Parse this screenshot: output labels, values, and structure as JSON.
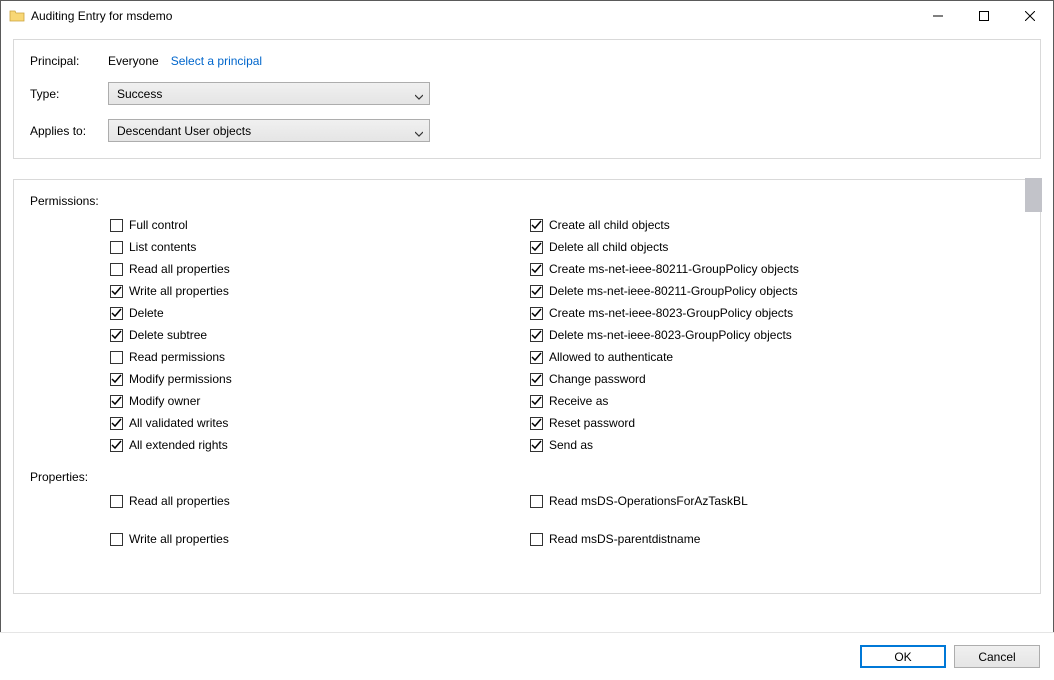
{
  "titlebar": {
    "title": "Auditing Entry for msdemo"
  },
  "top": {
    "principal_label": "Principal:",
    "principal_value": "Everyone",
    "principal_link": "Select a principal",
    "type_label": "Type:",
    "type_value": "Success",
    "applies_label": "Applies to:",
    "applies_value": "Descendant User objects"
  },
  "sections": {
    "permissions_label": "Permissions:",
    "properties_label": "Properties:"
  },
  "permissions_left": [
    {
      "label": "Full control",
      "checked": false
    },
    {
      "label": "List contents",
      "checked": false
    },
    {
      "label": "Read all properties",
      "checked": false
    },
    {
      "label": "Write all properties",
      "checked": true
    },
    {
      "label": "Delete",
      "checked": true
    },
    {
      "label": "Delete subtree",
      "checked": true
    },
    {
      "label": "Read permissions",
      "checked": false
    },
    {
      "label": "Modify permissions",
      "checked": true
    },
    {
      "label": "Modify owner",
      "checked": true
    },
    {
      "label": "All validated writes",
      "checked": true
    },
    {
      "label": "All extended rights",
      "checked": true
    }
  ],
  "permissions_right": [
    {
      "label": "Create all child objects",
      "checked": true
    },
    {
      "label": "Delete all child objects",
      "checked": true
    },
    {
      "label": "Create ms-net-ieee-80211-GroupPolicy objects",
      "checked": true
    },
    {
      "label": "Delete ms-net-ieee-80211-GroupPolicy objects",
      "checked": true
    },
    {
      "label": "Create ms-net-ieee-8023-GroupPolicy objects",
      "checked": true
    },
    {
      "label": "Delete ms-net-ieee-8023-GroupPolicy objects",
      "checked": true
    },
    {
      "label": "Allowed to authenticate",
      "checked": true
    },
    {
      "label": "Change password",
      "checked": true
    },
    {
      "label": "Receive as",
      "checked": true
    },
    {
      "label": "Reset password",
      "checked": true
    },
    {
      "label": "Send as",
      "checked": true
    }
  ],
  "properties_left": [
    {
      "label": "Read all properties",
      "checked": false
    },
    {
      "label": "Write all properties",
      "checked": false
    }
  ],
  "properties_right": [
    {
      "label": "Read msDS-OperationsForAzTaskBL",
      "checked": false
    },
    {
      "label": "Read msDS-parentdistname",
      "checked": false
    }
  ],
  "footer": {
    "ok_label": "OK",
    "cancel_label": "Cancel"
  }
}
